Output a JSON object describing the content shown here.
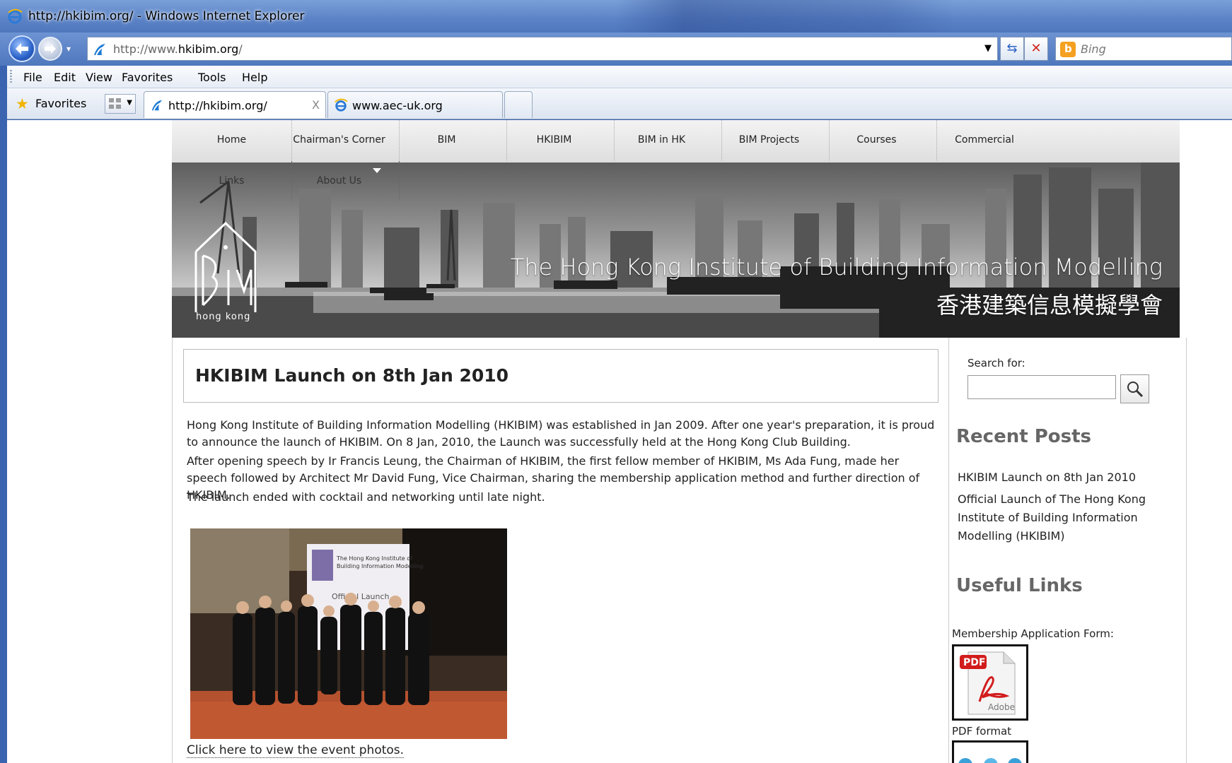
{
  "window": {
    "title": "http://hkibim.org/ - Windows Internet Explorer",
    "url_prefix": "http://www.",
    "url_domain": "hkibim.org",
    "url_suffix": "/",
    "search_placeholder": "Bing"
  },
  "menubar": {
    "items": [
      "File",
      "Edit",
      "View",
      "Favorites",
      "Tools",
      "Help"
    ]
  },
  "favorites_bar": {
    "favorites_label": "Favorites",
    "tabs": [
      {
        "label": "http://hkibim.org/",
        "active": true
      },
      {
        "label": "www.aec-uk.org",
        "active": false
      }
    ]
  },
  "site": {
    "nav": {
      "row1": [
        "Home",
        "Chairman's Corner",
        "BIM",
        "HKIBIM",
        "BIM in HK",
        "BIM Projects",
        "Courses",
        "Commercial"
      ],
      "row2": [
        "Links",
        "About Us"
      ]
    },
    "banner": {
      "title_en": "The Hong Kong Institute of Building Information Modelling",
      "title_zh": "香港建築信息模擬學會",
      "logo_text": "hong kong"
    },
    "post": {
      "title": "HKIBIM Launch on 8th Jan 2010",
      "paragraphs": [
        "Hong Kong Institute of Building Information Modelling (HKIBIM) was established in Jan 2009. After one year's preparation, it is proud to announce the launch of HKIBIM. On 8 Jan, 2010, the Launch was successfully held at the Hong Kong Club Building.",
        "After opening speech by Ir Francis Leung, the Chairman of HKIBIM, the first fellow member of HKIBIM, Ms Ada Fung, made her speech followed by Architect Mr David Fung, Vice Chairman, sharing the membership application method and further direction of HKIBIM.",
        "The launch ended with cocktail and networking until late night."
      ],
      "photo_link": "Click here to view the event photos."
    },
    "sidebar": {
      "search_label": "Search for:",
      "recent_posts_heading": "Recent Posts",
      "recent_posts": [
        "HKIBIM Launch on 8th Jan 2010",
        "Official Launch of The Hong Kong Institute of Building Information Modelling (HKIBIM)"
      ],
      "useful_links_heading": "Useful Links",
      "membership_label": "Membership Application Form:",
      "pdf_format_label": "PDF format"
    }
  }
}
